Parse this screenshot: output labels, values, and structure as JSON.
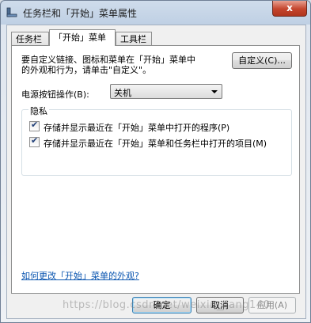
{
  "window": {
    "title": "任务栏和「开始」菜单属性",
    "close_label": "x"
  },
  "tabs": [
    {
      "label": "任务栏"
    },
    {
      "label": "「开始」菜单"
    },
    {
      "label": "工具栏"
    }
  ],
  "start_menu": {
    "customize_description": "要自定义链接、图标和菜单在「开始」菜单中的外观和行为，请单击\"自定义\"。",
    "customize_button": "自定义(C)...",
    "power_label": "电源按钮操作(B):",
    "power_value": "关机",
    "privacy": {
      "title": "隐私",
      "options": [
        {
          "label": "存储并显示最近在「开始」菜单中打开的程序(P)",
          "checked": true
        },
        {
          "label": "存储并显示最近在「开始」菜单和任务栏中打开的项目(M)",
          "checked": true
        }
      ]
    },
    "help_link": "如何更改「开始」菜单的外观?"
  },
  "buttons": {
    "ok": "确定",
    "cancel": "取消",
    "apply": "应用(A)"
  },
  "watermark": "https://blog.csdn.net/weixin_jiang140"
}
